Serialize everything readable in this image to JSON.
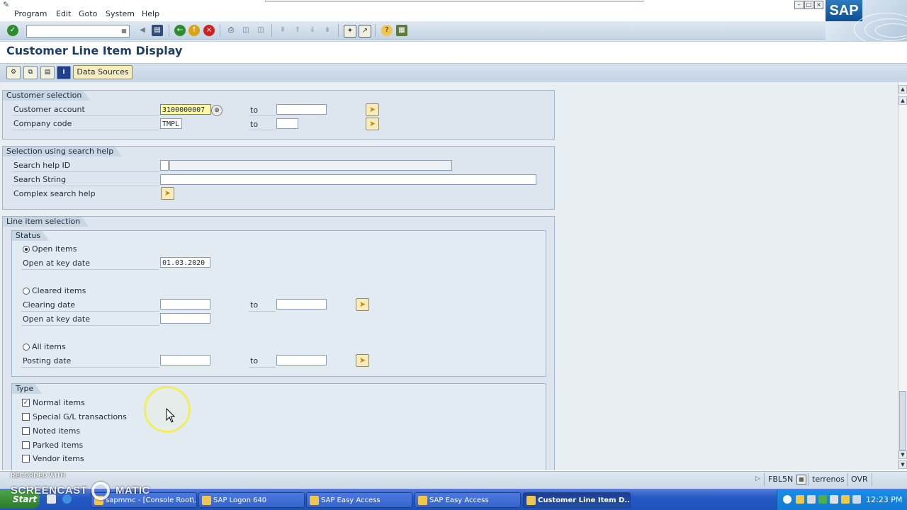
{
  "menu": {
    "items": [
      "Program",
      "Edit",
      "Goto",
      "System",
      "Help"
    ]
  },
  "brand": {
    "logo_text": "SAP"
  },
  "toolbar": {
    "icons": [
      "enter-icon",
      "command-field",
      "back-icon",
      "save-icon",
      "back-nav-icon",
      "exit-icon",
      "cancel-icon",
      "print-icon",
      "find-icon",
      "find-next-icon",
      "first-page-icon",
      "previous-page-icon",
      "next-page-icon",
      "last-page-icon",
      "new-session-icon",
      "shortcut-icon",
      "help-icon",
      "layout-icon"
    ]
  },
  "page": {
    "title": "Customer Line Item Display"
  },
  "app_toolbar": {
    "data_sources_label": "Data Sources"
  },
  "customer_selection": {
    "title": "Customer selection",
    "customer_account_label": "Customer account",
    "customer_account_value": "3100000007",
    "company_code_label": "Company code",
    "company_code_value": "TMPL",
    "to_label": "to"
  },
  "search_help": {
    "title": "Selection using search help",
    "search_help_id_label": "Search help ID",
    "search_string_label": "Search String",
    "complex_search_label": "Complex search help"
  },
  "line_item_selection": {
    "title": "Line item selection",
    "status": {
      "title": "Status",
      "open_items_label": "Open items",
      "open_key_date_label": "Open at key date",
      "open_key_date_value": "01.03.2020",
      "cleared_items_label": "Cleared items",
      "clearing_date_label": "Clearing date",
      "cleared_open_key_date_label": "Open at key date",
      "all_items_label": "All items",
      "posting_date_label": "Posting date",
      "to_label": "to"
    },
    "type": {
      "title": "Type",
      "normal_items_label": "Normal items",
      "special_gl_label": "Special G/L transactions",
      "noted_items_label": "Noted items",
      "parked_items_label": "Parked items",
      "vendor_items_label": "Vendor items"
    }
  },
  "status_bar": {
    "transaction": "FBL5N",
    "server": "terrenos",
    "mode": "OVR"
  },
  "taskbar": {
    "start_label": "Start",
    "tasks": [
      "sapmmc - [Console Root\\...",
      "SAP Logon 640",
      "SAP Easy Access",
      "SAP Easy Access",
      "Customer Line Item D..."
    ],
    "clock": "12:23 PM"
  },
  "watermark": {
    "line1": "RECORDED WITH",
    "line2": "SCREENCAST",
    "line3": "MATIC"
  }
}
